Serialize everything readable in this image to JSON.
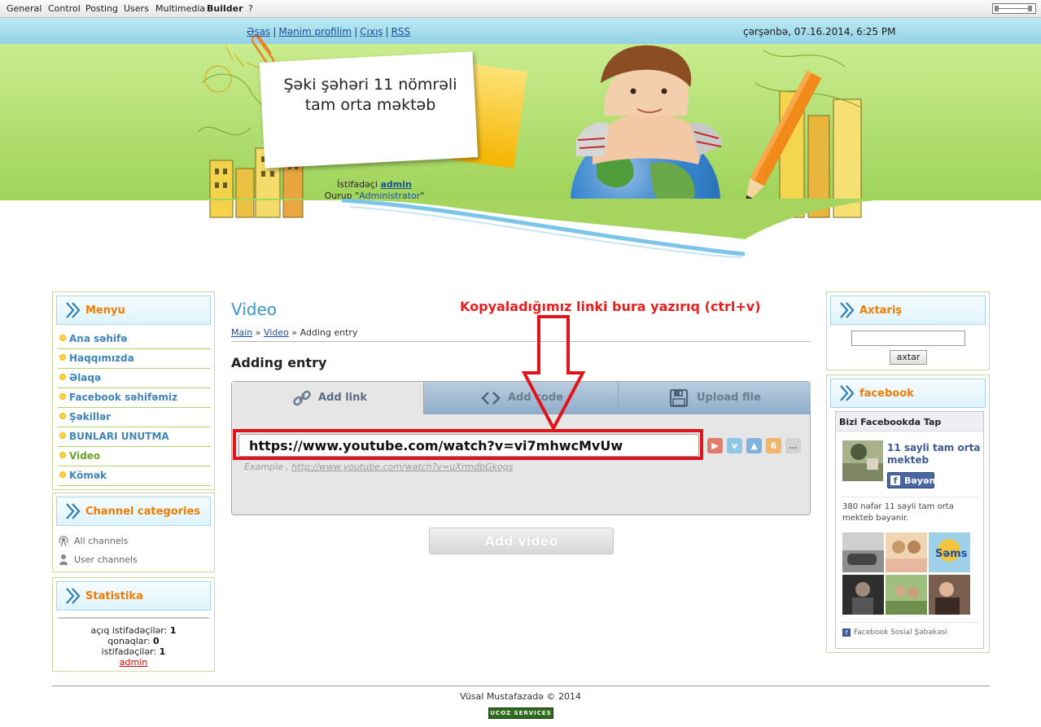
{
  "admin_bar": {
    "items": [
      "General",
      "Control",
      "Posting",
      "Users",
      "Multimedia",
      "Builder",
      "?"
    ]
  },
  "header": {
    "links": [
      "Əsas",
      "Mənim profilim",
      "Çıxış",
      "RSS"
    ],
    "date": "çərşənbə, 07.16.2014, 6:25 PM",
    "site_title_line1": "Şəki şəhəri 11 nömrəli",
    "site_title_line2": "tam orta məktəb",
    "user_prefix": "İstifadəçi",
    "user_name": "admin",
    "group_prefix": "Qurup \"",
    "group_name": "Administrator",
    "group_suffix": "\""
  },
  "sidebar_left": {
    "menu_title": "Menyu",
    "menu_items": [
      "Ana səhifə",
      "Haqqımızda",
      "Əlaqə",
      "Facebook səhifəmiz",
      "Şəkillər",
      "BUNLARI UNUTMA",
      "Video",
      "Kömək"
    ],
    "active_item": "Video",
    "channel_title": "Channel categories",
    "channel_items": [
      "All channels",
      "User channels"
    ],
    "stats_title": "Statistika",
    "stats": {
      "open_users_label": "açıq istifadəçilər:",
      "open_users": "1",
      "guests_label": "qonaqlar:",
      "guests": "0",
      "users_label": "istifadəçilər:",
      "users": "1",
      "online_user": "admin"
    }
  },
  "main": {
    "title": "Video",
    "breadcrumb": {
      "main": "Main",
      "video": "Video",
      "sep": "»",
      "current": "Adding entry"
    },
    "section_heading": "Adding entry",
    "annotation": "Kopyaladığımız linki bura yazırıq (ctrl+v)",
    "tabs": [
      "Add link",
      "Add code",
      "Upload file"
    ],
    "url_value": "https://www.youtube.com/watch?v=vi7mhwcMvUw",
    "example_prefix": "Example ,",
    "example_url": "http://www.youtube.com/watch?v=uXrmdbGkogs",
    "service_icons": [
      "youtube-icon",
      "vimeo-icon",
      "alarm-icon",
      "rutube-icon",
      "more-icon"
    ],
    "add_button": "Add video"
  },
  "sidebar_right": {
    "search_title": "Axtariş",
    "search_value": "",
    "search_button": "axtar",
    "facebook_title": "facebook",
    "fb": {
      "header": "Bizi Facebookda Tap",
      "page_name": "11 sayli tam orta mekteb",
      "like_label": "Bəyən",
      "count_text": "380 nəfər 11 sayli tam orta mekteb bəyənir.",
      "footer": "Facebook Sosial Şəbəkəsi"
    }
  },
  "footer": {
    "copyright": "Vüsal Mustafazadə © 2014",
    "badge": "UCOZ SERVICES"
  },
  "colors": {
    "accent_orange": "#f07d00",
    "link_blue": "#3f86b7",
    "annotation_red": "#e2141b",
    "facebook_blue": "#3b5998"
  }
}
